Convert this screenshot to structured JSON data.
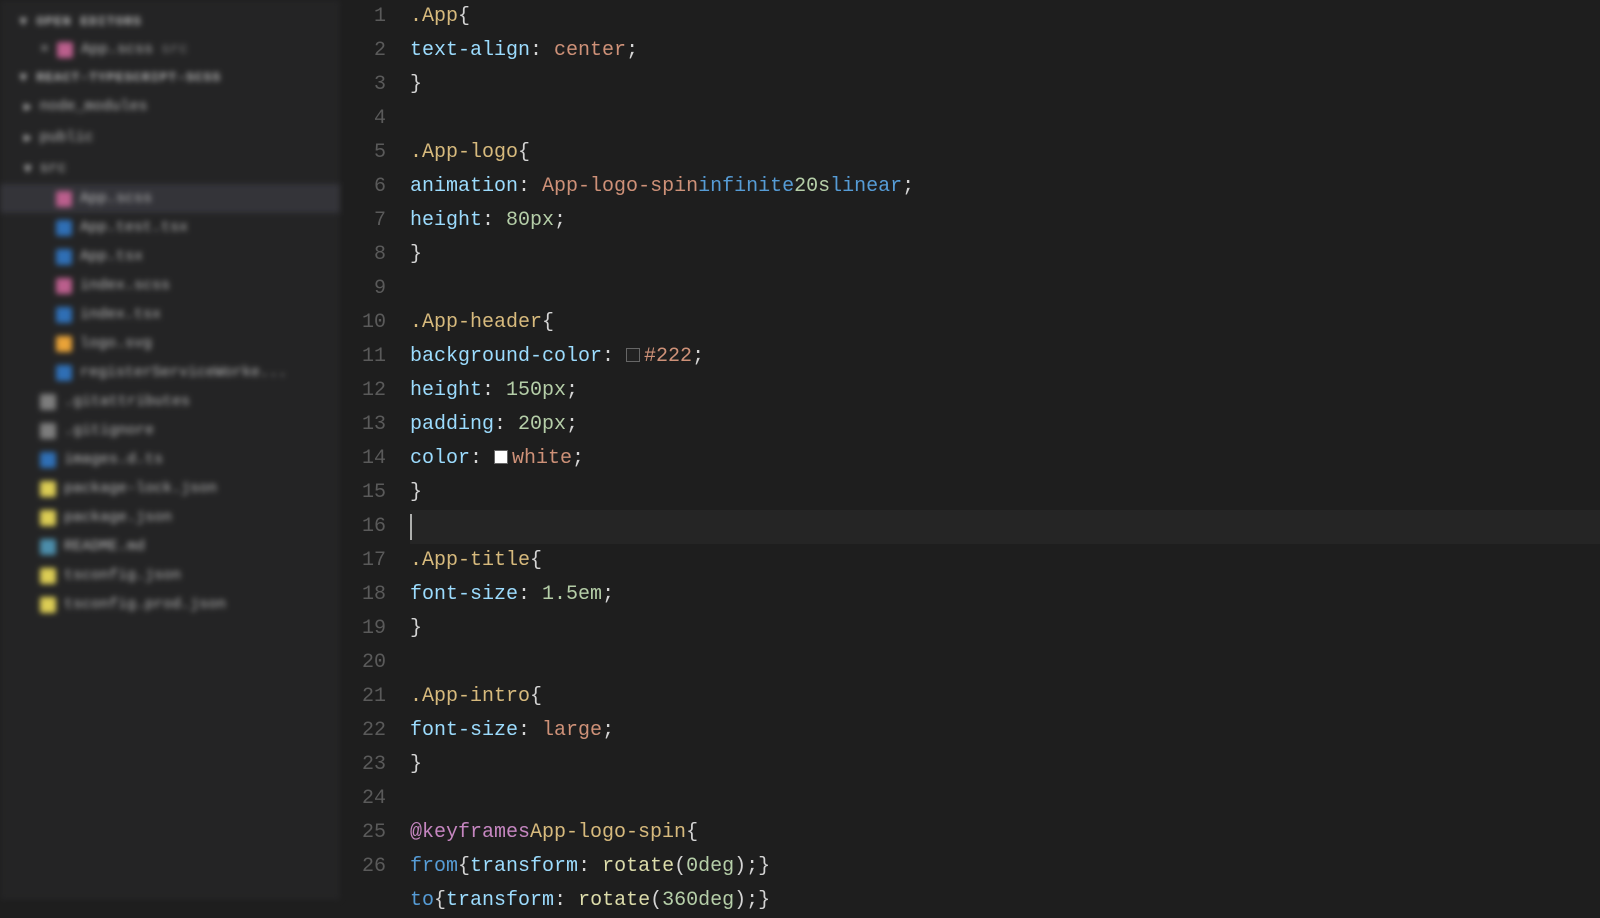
{
  "sidebar": {
    "open_editors_label": "OPEN EDITORS",
    "open_file": {
      "name": "App.scss",
      "dir": "src"
    },
    "project_label": "REACT-TYPESCRIPT-SCSS",
    "tree": [
      {
        "name": "node_modules",
        "type": "folder"
      },
      {
        "name": "public",
        "type": "folder"
      },
      {
        "name": "src",
        "type": "folder",
        "expanded": true
      },
      {
        "name": "App.scss",
        "type": "scss",
        "indent": 2,
        "active": true
      },
      {
        "name": "App.test.tsx",
        "type": "ts",
        "indent": 2
      },
      {
        "name": "App.tsx",
        "type": "ts",
        "indent": 2
      },
      {
        "name": "index.scss",
        "type": "scss",
        "indent": 2
      },
      {
        "name": "index.tsx",
        "type": "ts",
        "indent": 2
      },
      {
        "name": "logo.svg",
        "type": "svg",
        "indent": 2
      },
      {
        "name": "registerServiceWorke...",
        "type": "ts",
        "indent": 2
      },
      {
        "name": ".gitattributes",
        "type": "generic",
        "indent": 1
      },
      {
        "name": ".gitignore",
        "type": "generic",
        "indent": 1
      },
      {
        "name": "images.d.ts",
        "type": "ts",
        "indent": 1
      },
      {
        "name": "package-lock.json",
        "type": "json",
        "indent": 1
      },
      {
        "name": "package.json",
        "type": "json",
        "indent": 1
      },
      {
        "name": "README.md",
        "type": "md",
        "indent": 1
      },
      {
        "name": "tsconfig.json",
        "type": "json",
        "indent": 1
      },
      {
        "name": "tsconfig.prod.json",
        "type": "json",
        "indent": 1
      }
    ]
  },
  "editor": {
    "line_numbers_start": 1,
    "line_numbers_end": 26,
    "cursor_line": 16,
    "lines": [
      [
        {
          "t": "selector",
          "v": ".App"
        },
        {
          "t": "space",
          "v": " "
        },
        {
          "t": "brace",
          "v": "{"
        }
      ],
      [
        {
          "t": "indent",
          "v": "  "
        },
        {
          "t": "prop",
          "v": "text-align"
        },
        {
          "t": "punct",
          "v": ": "
        },
        {
          "t": "value",
          "v": "center"
        },
        {
          "t": "punct",
          "v": ";"
        }
      ],
      [
        {
          "t": "brace",
          "v": "}"
        }
      ],
      [],
      [
        {
          "t": "selector",
          "v": ".App-logo"
        },
        {
          "t": "space",
          "v": " "
        },
        {
          "t": "brace",
          "v": "{"
        }
      ],
      [
        {
          "t": "indent",
          "v": "  "
        },
        {
          "t": "prop",
          "v": "animation"
        },
        {
          "t": "punct",
          "v": ": "
        },
        {
          "t": "value",
          "v": "App-logo-spin"
        },
        {
          "t": "space",
          "v": " "
        },
        {
          "t": "const",
          "v": "infinite"
        },
        {
          "t": "space",
          "v": " "
        },
        {
          "t": "number",
          "v": "20s"
        },
        {
          "t": "space",
          "v": " "
        },
        {
          "t": "const",
          "v": "linear"
        },
        {
          "t": "punct",
          "v": ";"
        }
      ],
      [
        {
          "t": "indent",
          "v": "  "
        },
        {
          "t": "prop",
          "v": "height"
        },
        {
          "t": "punct",
          "v": ": "
        },
        {
          "t": "number",
          "v": "80px"
        },
        {
          "t": "punct",
          "v": ";"
        }
      ],
      [
        {
          "t": "brace",
          "v": "}"
        }
      ],
      [],
      [
        {
          "t": "selector",
          "v": ".App-header"
        },
        {
          "t": "space",
          "v": " "
        },
        {
          "t": "brace",
          "v": "{"
        }
      ],
      [
        {
          "t": "indent",
          "v": "  "
        },
        {
          "t": "prop",
          "v": "background-color"
        },
        {
          "t": "punct",
          "v": ": "
        },
        {
          "t": "swatch",
          "v": "222"
        },
        {
          "t": "value",
          "v": "#222"
        },
        {
          "t": "punct",
          "v": ";"
        }
      ],
      [
        {
          "t": "indent",
          "v": "  "
        },
        {
          "t": "prop",
          "v": "height"
        },
        {
          "t": "punct",
          "v": ": "
        },
        {
          "t": "number",
          "v": "150px"
        },
        {
          "t": "punct",
          "v": ";"
        }
      ],
      [
        {
          "t": "indent",
          "v": "  "
        },
        {
          "t": "prop",
          "v": "padding"
        },
        {
          "t": "punct",
          "v": ": "
        },
        {
          "t": "number",
          "v": "20px"
        },
        {
          "t": "punct",
          "v": ";"
        }
      ],
      [
        {
          "t": "indent",
          "v": "  "
        },
        {
          "t": "prop",
          "v": "color"
        },
        {
          "t": "punct",
          "v": ": "
        },
        {
          "t": "swatch",
          "v": "white"
        },
        {
          "t": "value",
          "v": "white"
        },
        {
          "t": "punct",
          "v": ";"
        }
      ],
      [
        {
          "t": "brace",
          "v": "}"
        }
      ],
      [
        {
          "t": "cursor",
          "v": ""
        }
      ],
      [
        {
          "t": "selector",
          "v": ".App-title"
        },
        {
          "t": "space",
          "v": " "
        },
        {
          "t": "brace",
          "v": "{"
        }
      ],
      [
        {
          "t": "indent",
          "v": "  "
        },
        {
          "t": "prop",
          "v": "font-size"
        },
        {
          "t": "punct",
          "v": ": "
        },
        {
          "t": "number",
          "v": "1.5em"
        },
        {
          "t": "punct",
          "v": ";"
        }
      ],
      [
        {
          "t": "brace",
          "v": "}"
        }
      ],
      [],
      [
        {
          "t": "selector",
          "v": ".App-intro"
        },
        {
          "t": "space",
          "v": " "
        },
        {
          "t": "brace",
          "v": "{"
        }
      ],
      [
        {
          "t": "indent",
          "v": "  "
        },
        {
          "t": "prop",
          "v": "font-size"
        },
        {
          "t": "punct",
          "v": ": "
        },
        {
          "t": "value",
          "v": "large"
        },
        {
          "t": "punct",
          "v": ";"
        }
      ],
      [
        {
          "t": "brace",
          "v": "}"
        }
      ],
      [],
      [
        {
          "t": "keyword",
          "v": "@keyframes"
        },
        {
          "t": "space",
          "v": " "
        },
        {
          "t": "selector",
          "v": "App-logo-spin"
        },
        {
          "t": "space",
          "v": " "
        },
        {
          "t": "brace",
          "v": "{"
        }
      ],
      [
        {
          "t": "indent",
          "v": "  "
        },
        {
          "t": "const",
          "v": "from"
        },
        {
          "t": "space",
          "v": " "
        },
        {
          "t": "brace",
          "v": "{"
        },
        {
          "t": "space",
          "v": " "
        },
        {
          "t": "prop",
          "v": "transform"
        },
        {
          "t": "punct",
          "v": ": "
        },
        {
          "t": "func",
          "v": "rotate"
        },
        {
          "t": "punct",
          "v": "("
        },
        {
          "t": "number",
          "v": "0deg"
        },
        {
          "t": "punct",
          "v": ");"
        },
        {
          "t": "space",
          "v": " "
        },
        {
          "t": "brace",
          "v": "}"
        }
      ],
      [
        {
          "t": "indent",
          "v": "  "
        },
        {
          "t": "const",
          "v": "to"
        },
        {
          "t": "space",
          "v": " "
        },
        {
          "t": "brace",
          "v": "{"
        },
        {
          "t": "space",
          "v": " "
        },
        {
          "t": "prop",
          "v": "transform"
        },
        {
          "t": "punct",
          "v": ": "
        },
        {
          "t": "func",
          "v": "rotate"
        },
        {
          "t": "punct",
          "v": "("
        },
        {
          "t": "number",
          "v": "360deg"
        },
        {
          "t": "punct",
          "v": ");"
        },
        {
          "t": "space",
          "v": " "
        },
        {
          "t": "brace",
          "v": "}"
        }
      ]
    ]
  }
}
